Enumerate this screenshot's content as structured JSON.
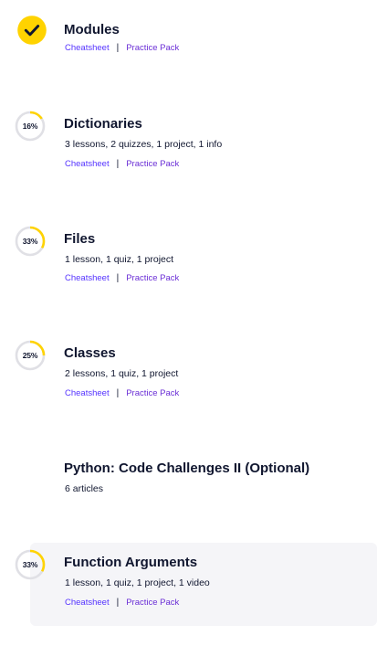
{
  "colors": {
    "accent": "#ffd300",
    "ring": "#e0e0e5",
    "link": "#5533ff",
    "text": "#10162f",
    "highlight_bg": "#f5f5f8"
  },
  "modules": [
    {
      "title": "Modules",
      "status": "complete",
      "icon": "checkmark-icon",
      "links": [
        "Cheatsheet",
        "Practice Pack"
      ]
    },
    {
      "title": "Dictionaries",
      "progress": 0.16,
      "progress_label": "16%",
      "meta": "3 lessons, 2 quizzes, 1 project, 1 info",
      "links": [
        "Cheatsheet",
        "Practice Pack"
      ]
    },
    {
      "title": "Files",
      "progress": 0.33,
      "progress_label": "33%",
      "meta": "1 lesson, 1 quiz, 1 project",
      "links": [
        "Cheatsheet",
        "Practice Pack"
      ]
    },
    {
      "title": "Classes",
      "progress": 0.25,
      "progress_label": "25%",
      "meta": "2 lessons, 1 quiz, 1 project",
      "links": [
        "Cheatsheet",
        "Practice Pack"
      ]
    },
    {
      "title": "Python: Code Challenges II (Optional)",
      "meta": "6 articles"
    },
    {
      "title": "Function Arguments",
      "progress": 0.33,
      "progress_label": "33%",
      "meta": "1 lesson, 1 quiz, 1 project, 1 video",
      "links": [
        "Cheatsheet",
        "Practice Pack"
      ]
    }
  ],
  "link_separator": "|"
}
